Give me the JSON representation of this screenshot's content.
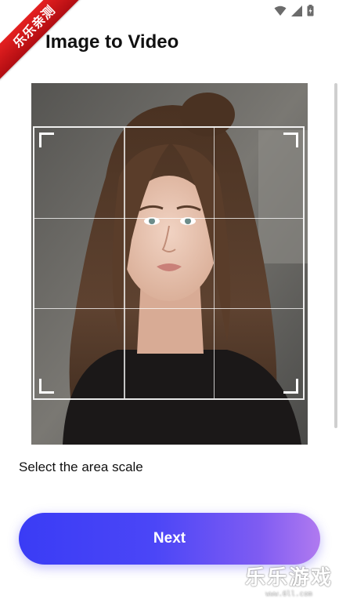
{
  "status_bar": {
    "icons": [
      "wifi-icon",
      "signal-icon",
      "battery-icon"
    ]
  },
  "ribbon": {
    "text": "乐乐亲测"
  },
  "header": {
    "title": "Image to Video"
  },
  "crop": {
    "grid": "3x3"
  },
  "main": {
    "scale_label": "Select the area scale",
    "next_label": "Next"
  },
  "watermark": {
    "main": "乐乐游戏",
    "sub": "www.6ll.com"
  },
  "colors": {
    "button_gradient_start": "#3a3cf5",
    "button_gradient_end": "#b07af0",
    "ribbon": "#d8181c",
    "title": "#111111"
  }
}
